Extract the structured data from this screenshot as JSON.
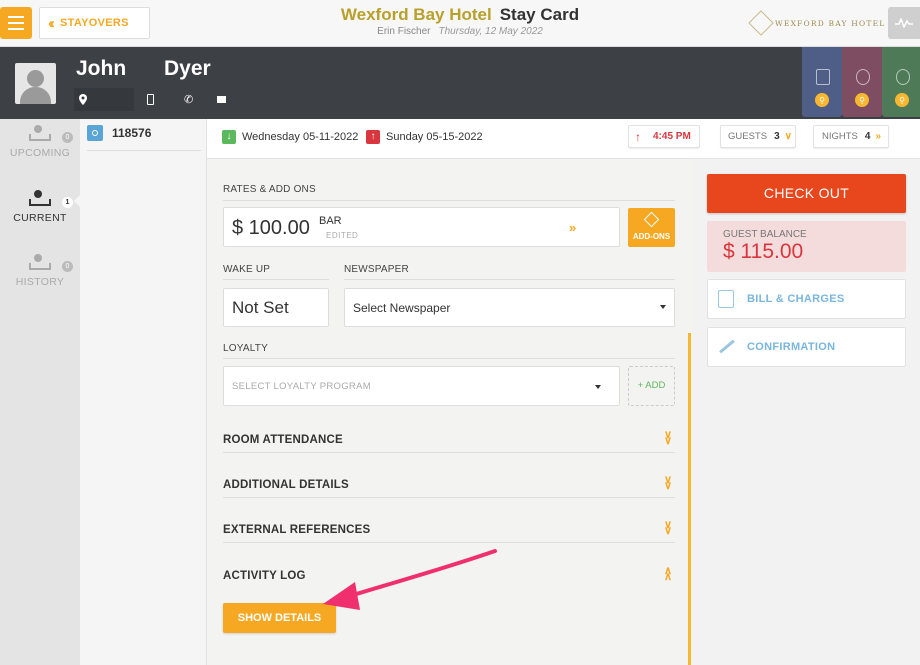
{
  "topbar": {
    "back_label": "STAYOVERS",
    "hotel_name": "Wexford Bay Hotel",
    "page_title": "Stay Card",
    "user_name": "Erin Fischer",
    "business_date": "Thursday, 12 May 2022",
    "brand_text": "WEXFORD BAY HOTEL"
  },
  "guest": {
    "first_name": "John",
    "last_name": "Dyer"
  },
  "left_nav": {
    "items": [
      {
        "label": "UPCOMING",
        "count": "0"
      },
      {
        "label": "CURRENT",
        "count": "1"
      },
      {
        "label": "HISTORY",
        "count": "0"
      }
    ]
  },
  "reservation": {
    "number": "118576"
  },
  "dates": {
    "arrival": "Wednesday 05-11-2022",
    "departure": "Sunday 05-15-2022",
    "departure_time": "4:45 PM",
    "guests_label": "GUESTS",
    "guests_count": "3",
    "nights_label": "NIGHTS",
    "nights_count": "4"
  },
  "rates": {
    "section_label": "RATES & ADD ONS",
    "amount": "$ 100.00",
    "code": "BAR",
    "status": "EDITED",
    "addons_label": "ADD-ONS"
  },
  "wake_up": {
    "label": "WAKE UP",
    "value": "Not Set"
  },
  "newspaper": {
    "label": "NEWSPAPER",
    "value": "Select Newspaper"
  },
  "loyalty": {
    "label": "LOYALTY",
    "placeholder": "SELECT LOYALTY PROGRAM",
    "add_label": "+ ADD"
  },
  "accordions": [
    {
      "title": "ROOM ATTENDANCE"
    },
    {
      "title": "ADDITIONAL DETAILS"
    },
    {
      "title": "EXTERNAL REFERENCES"
    },
    {
      "title": "ACTIVITY LOG"
    }
  ],
  "activity_log": {
    "show_details_label": "SHOW DETAILS"
  },
  "right": {
    "checkout_label": "CHECK OUT",
    "balance_label": "GUEST BALANCE",
    "balance_amount": "$ 115.00",
    "bill_label": "BILL & CHARGES",
    "confirmation_label": "CONFIRMATION"
  },
  "colors": {
    "accent": "#f7a823",
    "checkout": "#e8461c",
    "balance_text": "#d9363e",
    "link": "#79b6dd",
    "annotation": "#f0306e"
  },
  "icons": [
    "menu-icon",
    "chevron-double-left-icon",
    "maple-leaf-icon",
    "activity-icon",
    "location-icon",
    "mobile-icon",
    "phone-icon",
    "mail-icon",
    "magnify-icon",
    "bed-icon",
    "reservation-icon",
    "arrow-down-icon",
    "arrow-up-icon",
    "chevron-double-down-icon",
    "chevron-double-right-icon",
    "stack-icon",
    "chevron-up-icon",
    "calculator-icon",
    "wand-icon"
  ]
}
